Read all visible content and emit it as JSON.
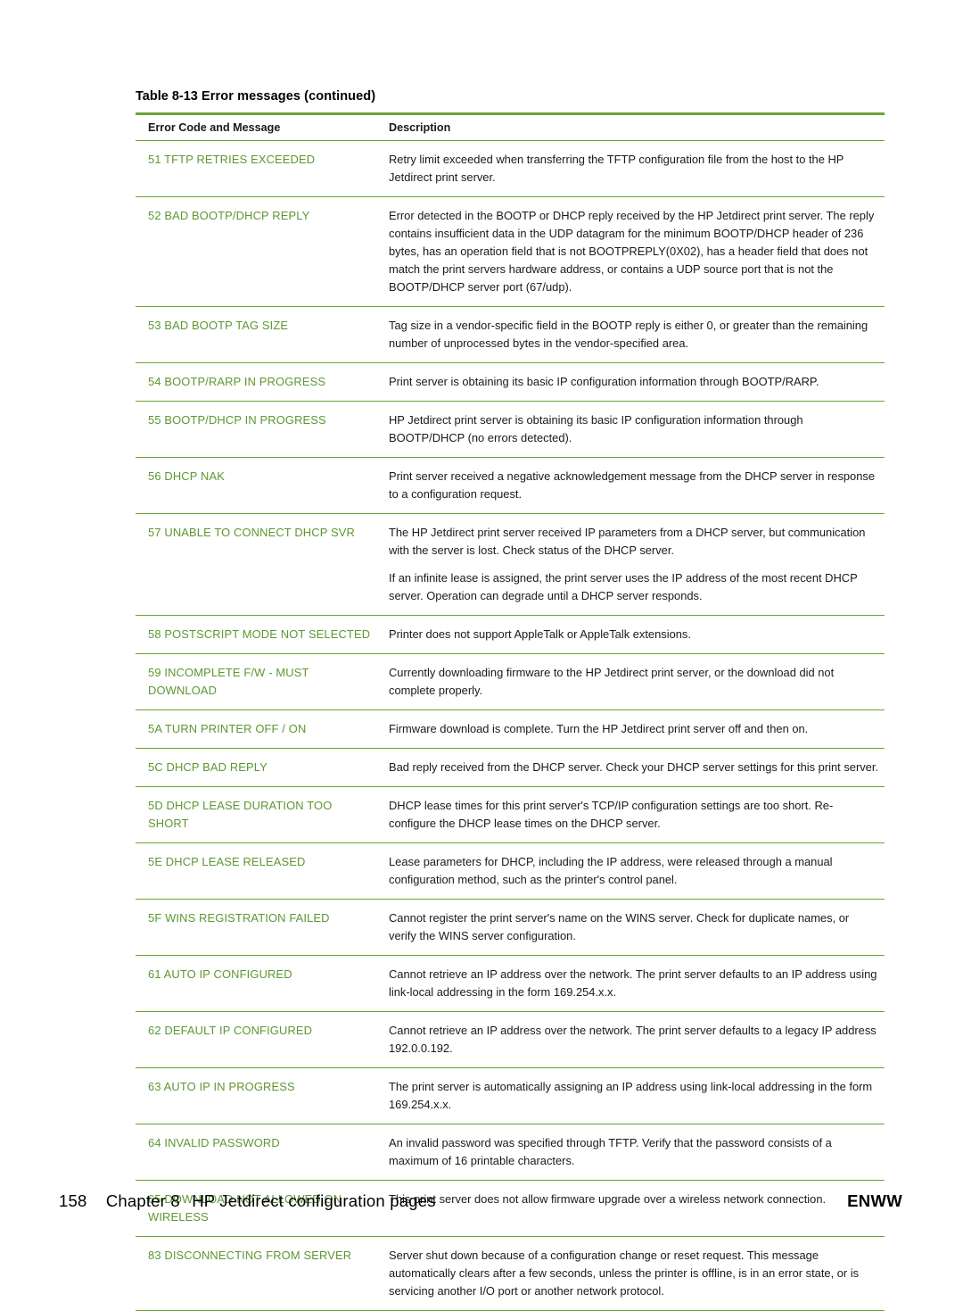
{
  "table": {
    "caption_number": "Table 8-13",
    "caption_text": "Error messages (continued)",
    "headers": {
      "col1": "Error Code and Message",
      "col2": "Description"
    },
    "rows": [
      {
        "code": "51 TFTP RETRIES EXCEEDED",
        "desc": "Retry limit exceeded when transferring the TFTP configuration file from the host to the HP Jetdirect print server."
      },
      {
        "code": "52 BAD BOOTP/DHCP REPLY",
        "desc": "Error detected in the BOOTP or DHCP reply received by the HP Jetdirect print server. The reply contains insufficient data in the UDP datagram for the minimum BOOTP/DHCP header of 236 bytes, has an operation field that is not BOOTPREPLY(0X02), has a header field that does not match the print servers hardware address, or contains a UDP source port that is not the BOOTP/DHCP server port (67/udp)."
      },
      {
        "code": "53 BAD BOOTP TAG SIZE",
        "desc": "Tag size in a vendor-specific field in the BOOTP reply is either 0, or greater than the remaining number of unprocessed bytes in the vendor-specified area."
      },
      {
        "code": "54 BOOTP/RARP IN PROGRESS",
        "desc": "Print server is obtaining its basic IP configuration information through BOOTP/RARP."
      },
      {
        "code": "55 BOOTP/DHCP IN PROGRESS",
        "desc": "HP Jetdirect print server is obtaining its basic IP configuration information through BOOTP/DHCP (no errors detected)."
      },
      {
        "code": "56 DHCP NAK",
        "desc": "Print server received a negative acknowledgement message from the DHCP server in response to a configuration request."
      },
      {
        "code": "57 UNABLE TO CONNECT DHCP SVR",
        "desc": "The HP Jetdirect print server received IP parameters from a DHCP server, but communication with the server is lost. Check status of the DHCP server.",
        "desc2": "If an infinite lease is assigned, the print server uses the IP address of the most recent DHCP server. Operation can degrade until a DHCP server responds."
      },
      {
        "code": "58 POSTSCRIPT MODE NOT SELECTED",
        "desc": "Printer does not support AppleTalk or AppleTalk extensions."
      },
      {
        "code": "59 INCOMPLETE F/W - MUST DOWNLOAD",
        "desc": "Currently downloading firmware to the HP Jetdirect print server, or the download did not complete properly."
      },
      {
        "code": "5A TURN PRINTER OFF / ON",
        "desc": "Firmware download is complete. Turn the HP Jetdirect print server off and then on."
      },
      {
        "code": "5C DHCP BAD REPLY",
        "desc": "Bad reply received from the DHCP server. Check your DHCP server settings for this print server."
      },
      {
        "code": "5D DHCP LEASE DURATION TOO SHORT",
        "desc": "DHCP lease times for this print server's TCP/IP configuration settings are too short. Re-configure the DHCP lease times on the DHCP server."
      },
      {
        "code": "5E DHCP LEASE RELEASED",
        "desc": "Lease parameters for DHCP, including the IP address, were released through a manual configuration method, such as the printer's control panel."
      },
      {
        "code": "5F WINS REGISTRATION FAILED",
        "desc": "Cannot register the print server's name on the WINS server. Check for duplicate names, or verify the WINS server configuration."
      },
      {
        "code": "61 AUTO IP CONFIGURED",
        "desc": "Cannot retrieve an IP address over the network. The print server defaults to an IP address using link-local addressing in the form 169.254.x.x."
      },
      {
        "code": "62 DEFAULT IP CONFIGURED",
        "desc": "Cannot retrieve an IP address over the network. The print server defaults to a legacy IP address 192.0.0.192."
      },
      {
        "code": "63 AUTO IP IN PROGRESS",
        "desc": "The print server is automatically assigning an IP address using link-local addressing in the form 169.254.x.x."
      },
      {
        "code": "64 INVALID PASSWORD",
        "desc": "An invalid password was specified through TFTP. Verify that the password consists of a maximum of 16 printable characters."
      },
      {
        "code": "65 DOWNLOAD NOT ALLOWED ON WIRELESS",
        "desc": "This print server does not allow firmware upgrade over a wireless network connection."
      },
      {
        "code": "83 DISCONNECTING FROM SERVER",
        "desc": "Server shut down because of a configuration change or reset request. This message automatically clears after a few seconds, unless the printer is offline, is in an error state, or is servicing another I/O port or another network protocol."
      }
    ]
  },
  "footer": {
    "page_number": "158",
    "chapter": "Chapter 8",
    "chapter_title": "HP Jetdirect configuration pages",
    "brand": "ENWW"
  }
}
